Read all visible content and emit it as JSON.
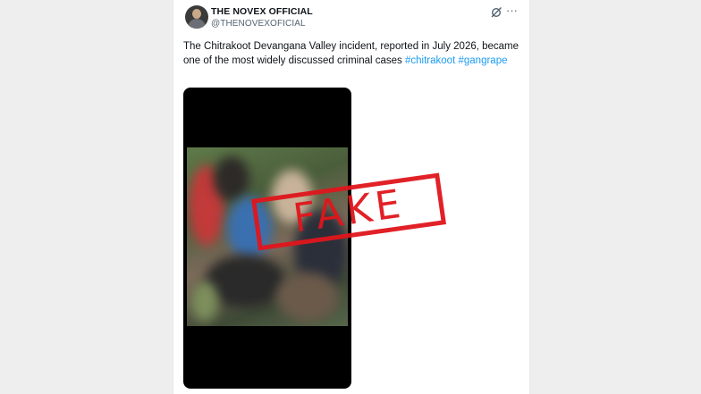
{
  "post": {
    "author": {
      "display_name": "THE NOVEX OFFICIAL",
      "handle": "@THENOVEXOFICIAL"
    },
    "text": "The Chitrakoot Devangana Valley incident, reported in July 2026, became one of the most widely discussed criminal cases",
    "hashtags": [
      "#chitrakoot",
      "#gangrape"
    ],
    "icons": {
      "grok": "grok-icon",
      "more": "more-options-icon"
    },
    "more_glyph": "···"
  },
  "overlay": {
    "stamp_text": "FAKE",
    "stamp_color": "#e0161c"
  },
  "colors": {
    "link": "#1d9bf0",
    "text": "#0f1419",
    "muted": "#536471"
  }
}
